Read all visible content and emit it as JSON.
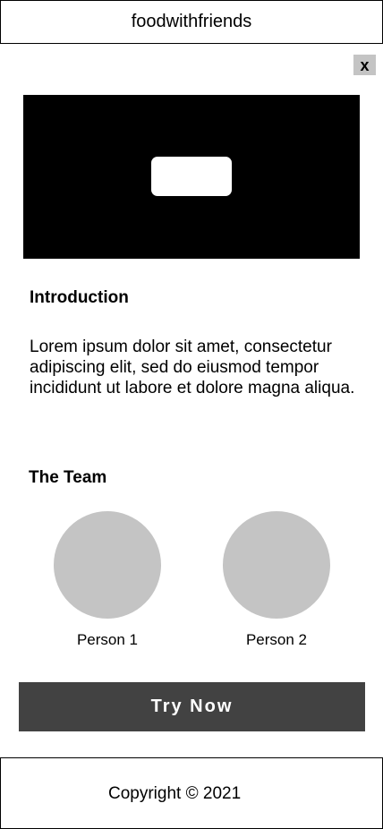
{
  "header": {
    "title": "foodwithfriends"
  },
  "close_label": "x",
  "video": {
    "play_icon": "play-button-icon"
  },
  "intro": {
    "title": "Introduction",
    "body": "Lorem ipsum dolor sit amet, consectetur adipiscing elit, sed do eiusmod tempor incididunt ut labore et dolore magna aliqua."
  },
  "team": {
    "title": "The Team",
    "members": [
      {
        "name": "Person 1"
      },
      {
        "name": "Person 2"
      }
    ]
  },
  "cta": {
    "label": "Try Now"
  },
  "footer": {
    "copyright": "Copyright © 2021"
  },
  "colors": {
    "button_bg": "#424242",
    "avatar_bg": "#c4c4c4",
    "close_bg": "#c4c4c4",
    "video_bg": "#000000"
  }
}
